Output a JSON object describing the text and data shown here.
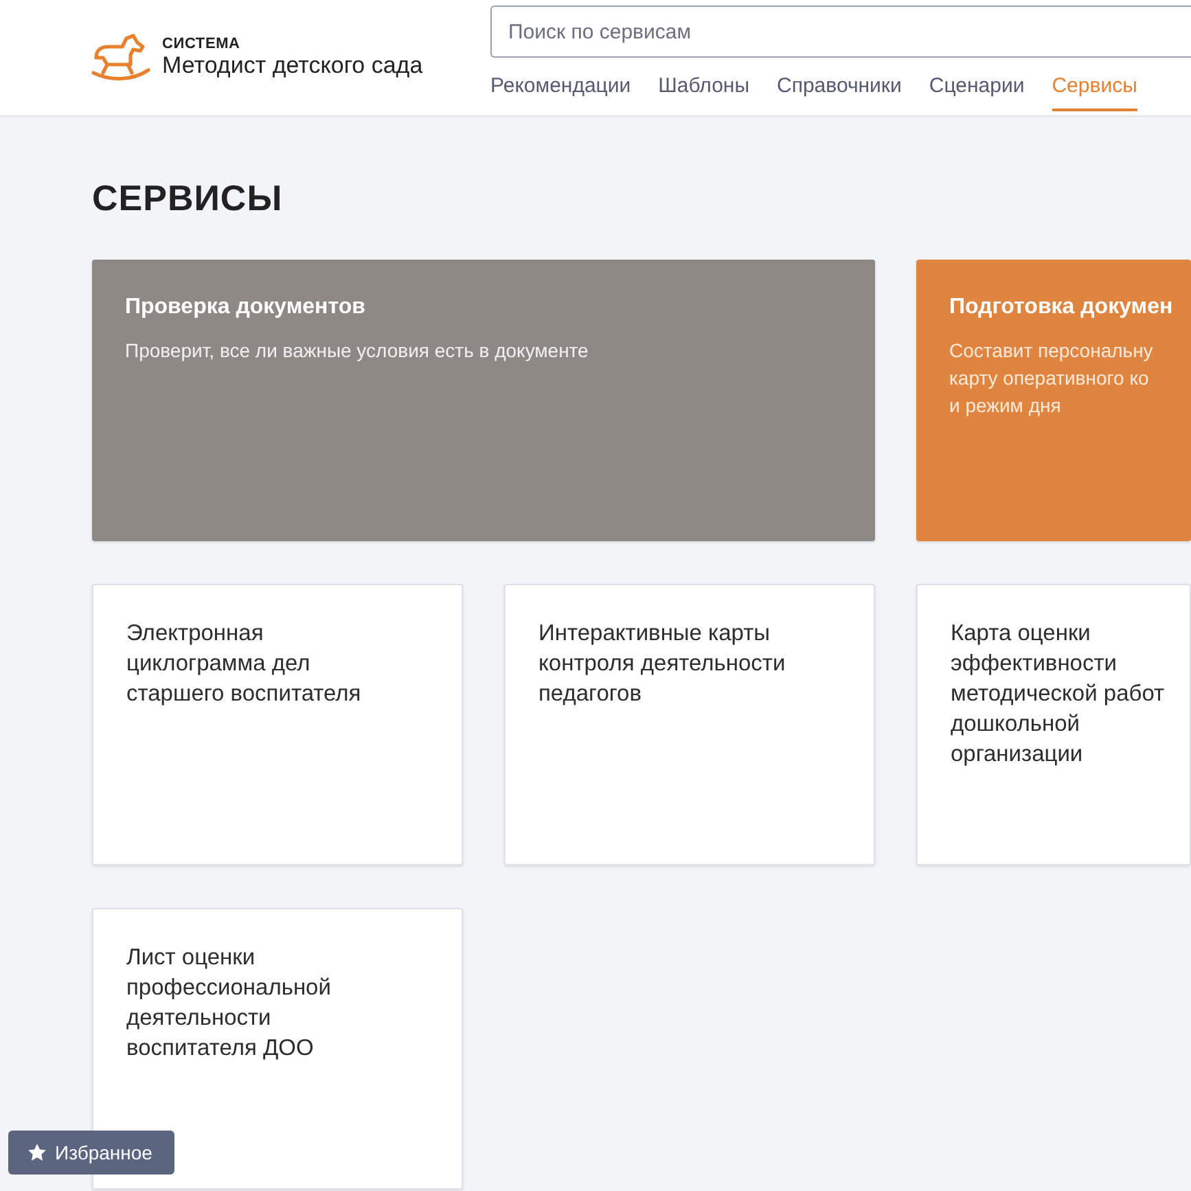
{
  "header": {
    "logo_caption": "СИСТЕМА",
    "logo_title": "Методист детского сада",
    "search": {
      "placeholder": "Поиск по сервисам"
    },
    "nav": [
      {
        "label": "Рекомендации",
        "selected": false
      },
      {
        "label": "Шаблоны",
        "selected": false
      },
      {
        "label": "Справочники",
        "selected": false
      },
      {
        "label": "Сценарии",
        "selected": false
      },
      {
        "label": "Сервисы",
        "selected": true
      }
    ]
  },
  "page_title": "СЕРВИСЫ",
  "cards": [
    {
      "kind": "gray",
      "title_lines": [
        "Проверка документов"
      ],
      "text_lines": [
        "Проверит, все ли важные условия есть в документе"
      ]
    },
    {
      "kind": "orange",
      "title_lines": [
        "Подготовка докумен"
      ],
      "text_lines": [
        "Составит персональну",
        "карту оперативного ко",
        "и режим дня"
      ]
    },
    {
      "kind": "white",
      "title_lines": [
        "Электронная",
        "циклограмма дел",
        "старшего воспитателя"
      ]
    },
    {
      "kind": "white",
      "title_lines": [
        "Интерактивные карты",
        "контроля деятельности",
        "педагогов"
      ]
    },
    {
      "kind": "white",
      "title_lines": [
        "Карта оценки",
        "эффективности",
        "методической работ",
        "дошкольной",
        "организации"
      ]
    },
    {
      "kind": "white",
      "title_lines": [
        "Лист оценки",
        "профессиональной",
        "деятельности",
        "воспитателя ДОО"
      ]
    }
  ],
  "favorites_button": "Избранное"
}
